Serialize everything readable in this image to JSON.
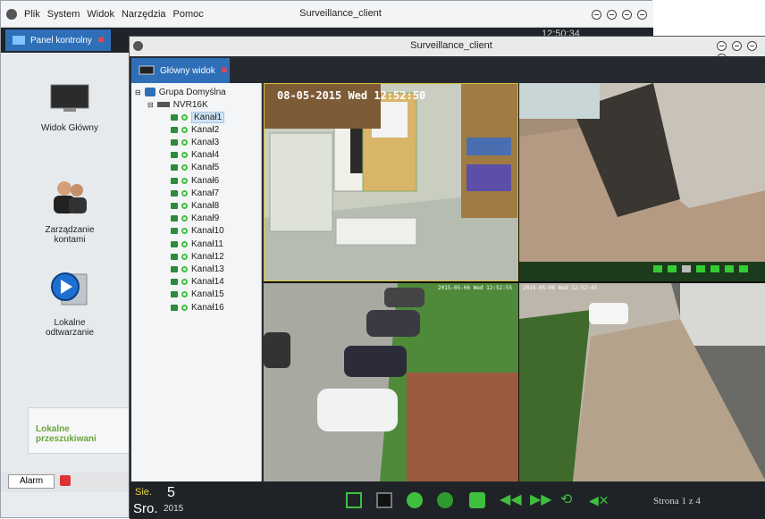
{
  "back_window": {
    "title": "Surveillance_client",
    "menu": [
      "Plik",
      "System",
      "Widok",
      "Narzędzia",
      "Pomoc"
    ],
    "tab_label": "Panel kontrolny",
    "clock": "12:50:34",
    "tiles": [
      {
        "label": "Widok Główny",
        "icon": "monitor-icon"
      },
      {
        "label": "Zarządzanie\nkontami",
        "icon": "users-icon"
      },
      {
        "label": "Lokalne\nodtwarzanie",
        "icon": "playback-icon"
      }
    ],
    "search_text": "Lokalne przeszukiwani",
    "alarm_button": "Alarm"
  },
  "main_window": {
    "title": "Surveillance_client",
    "tab_label": "Główny widok",
    "tree": {
      "group": "Grupa Domyślna",
      "device": "NVR16K",
      "channels": [
        "Kanał1",
        "Kanał2",
        "Kanał3",
        "Kanał4",
        "Kanał5",
        "Kanał6",
        "Kanał7",
        "Kanał8",
        "Kanał9",
        "Kanał10",
        "Kanał11",
        "Kanał12",
        "Kanał13",
        "Kanał14",
        "Kanał15",
        "Kanał16"
      ],
      "selected_index": 0
    },
    "video": {
      "osd_main": "08-05-2015 Wed 12:52:50",
      "osd_small_1": "2015-05-06 Wed 12:52:55",
      "osd_small_2": "2015-05-06 Wed 12:52:45"
    },
    "bottom": {
      "day_label": "Sie.",
      "day": "5",
      "dow": "Sro.",
      "year": "2015",
      "page_text": "Strona 1 z 4"
    }
  },
  "colors": {
    "accent_blue": "#2f6fb8",
    "rec_green": "#3fbf3f",
    "dark_bg": "#2a2e34"
  }
}
